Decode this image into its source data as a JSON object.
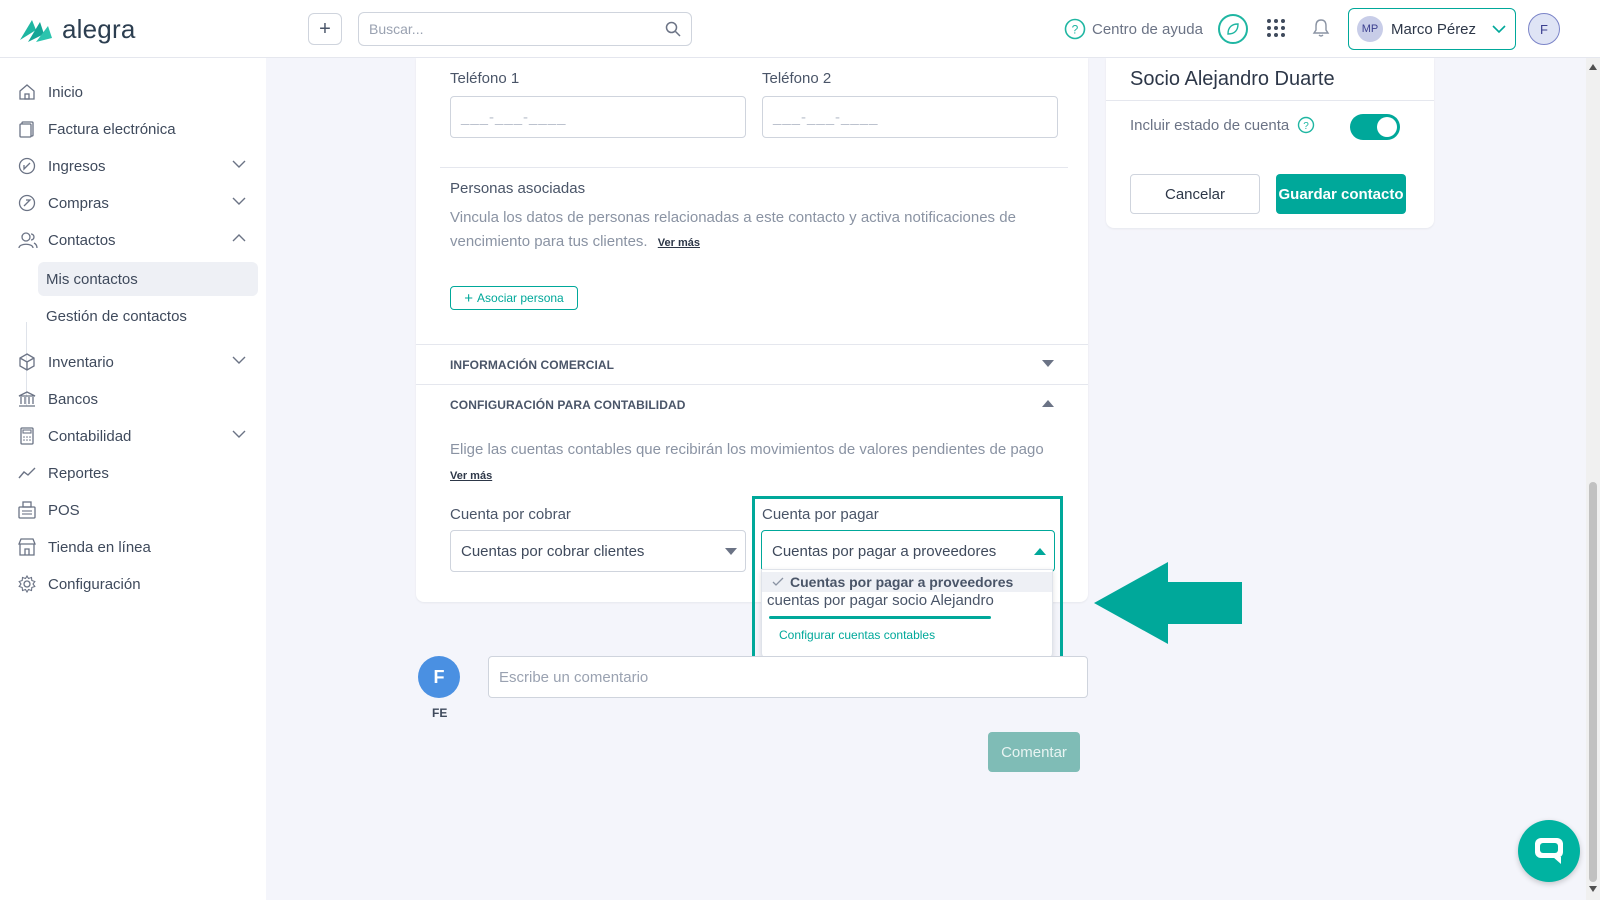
{
  "app": {
    "logo_text": "alegra"
  },
  "topbar": {
    "search_placeholder": "Buscar...",
    "help_label": "Centro de ayuda",
    "user_initials": "MP",
    "user_name": "Marco Pérez",
    "avatar_letter": "F"
  },
  "sidebar": {
    "items": [
      {
        "label": "Inicio",
        "icon": "home-icon"
      },
      {
        "label": "Factura electrónica",
        "icon": "document-icon"
      },
      {
        "label": "Ingresos",
        "icon": "income-icon"
      },
      {
        "label": "Compras",
        "icon": "purchases-icon"
      },
      {
        "label": "Contactos",
        "icon": "contacts-icon"
      },
      {
        "label": "Inventario",
        "icon": "box-icon"
      },
      {
        "label": "Bancos",
        "icon": "bank-icon"
      },
      {
        "label": "Contabilidad",
        "icon": "calculator-icon"
      },
      {
        "label": "Reportes",
        "icon": "chart-icon"
      },
      {
        "label": "POS",
        "icon": "register-icon"
      },
      {
        "label": "Tienda en línea",
        "icon": "store-icon"
      },
      {
        "label": "Configuración",
        "icon": "gear-icon"
      }
    ],
    "sub_items": [
      {
        "label": "Mis contactos",
        "active": true
      },
      {
        "label": "Gestión de contactos",
        "active": false
      }
    ]
  },
  "form": {
    "phone1_label": "Teléfono 1",
    "phone2_label": "Teléfono 2",
    "phone_mask": "___-___-____",
    "associated_title": "Personas asociadas",
    "associated_desc": "Vincula los datos de personas relacionadas a este contacto y activa notificaciones de vencimiento para tus clientes.",
    "ver_mas": "Ver más",
    "associate_button": "Asociar persona",
    "commercial_section": "INFORMACIÓN COMERCIAL",
    "accounting_section": "CONFIGURACIÓN PARA CONTABILIDAD",
    "accounting_desc": "Elige las cuentas contables que recibirán los movimientos de valores pendientes de pago",
    "receivable_label": "Cuenta por cobrar",
    "receivable_value": "Cuentas por cobrar clientes",
    "payable_label": "Cuenta por pagar",
    "payable_value": "Cuentas por pagar a proveedores",
    "payable_options": [
      "Cuentas por pagar a proveedores",
      "cuentas por pagar socio Alejandro"
    ],
    "configure_accounts": "Configurar cuentas contables"
  },
  "right_panel": {
    "title": "Socio Alejandro Duarte",
    "include_statement": "Incluir estado de cuenta",
    "include_statement_on": true,
    "cancel_button": "Cancelar",
    "save_button": "Guardar contacto"
  },
  "comment": {
    "avatar_letter": "F",
    "user_initials": "FE",
    "placeholder": "Escribe un comentario",
    "button": "Comentar"
  },
  "colors": {
    "accent": "#00a89a",
    "arrow": "#00a89a",
    "avatar_blue": "#4a90e2"
  }
}
